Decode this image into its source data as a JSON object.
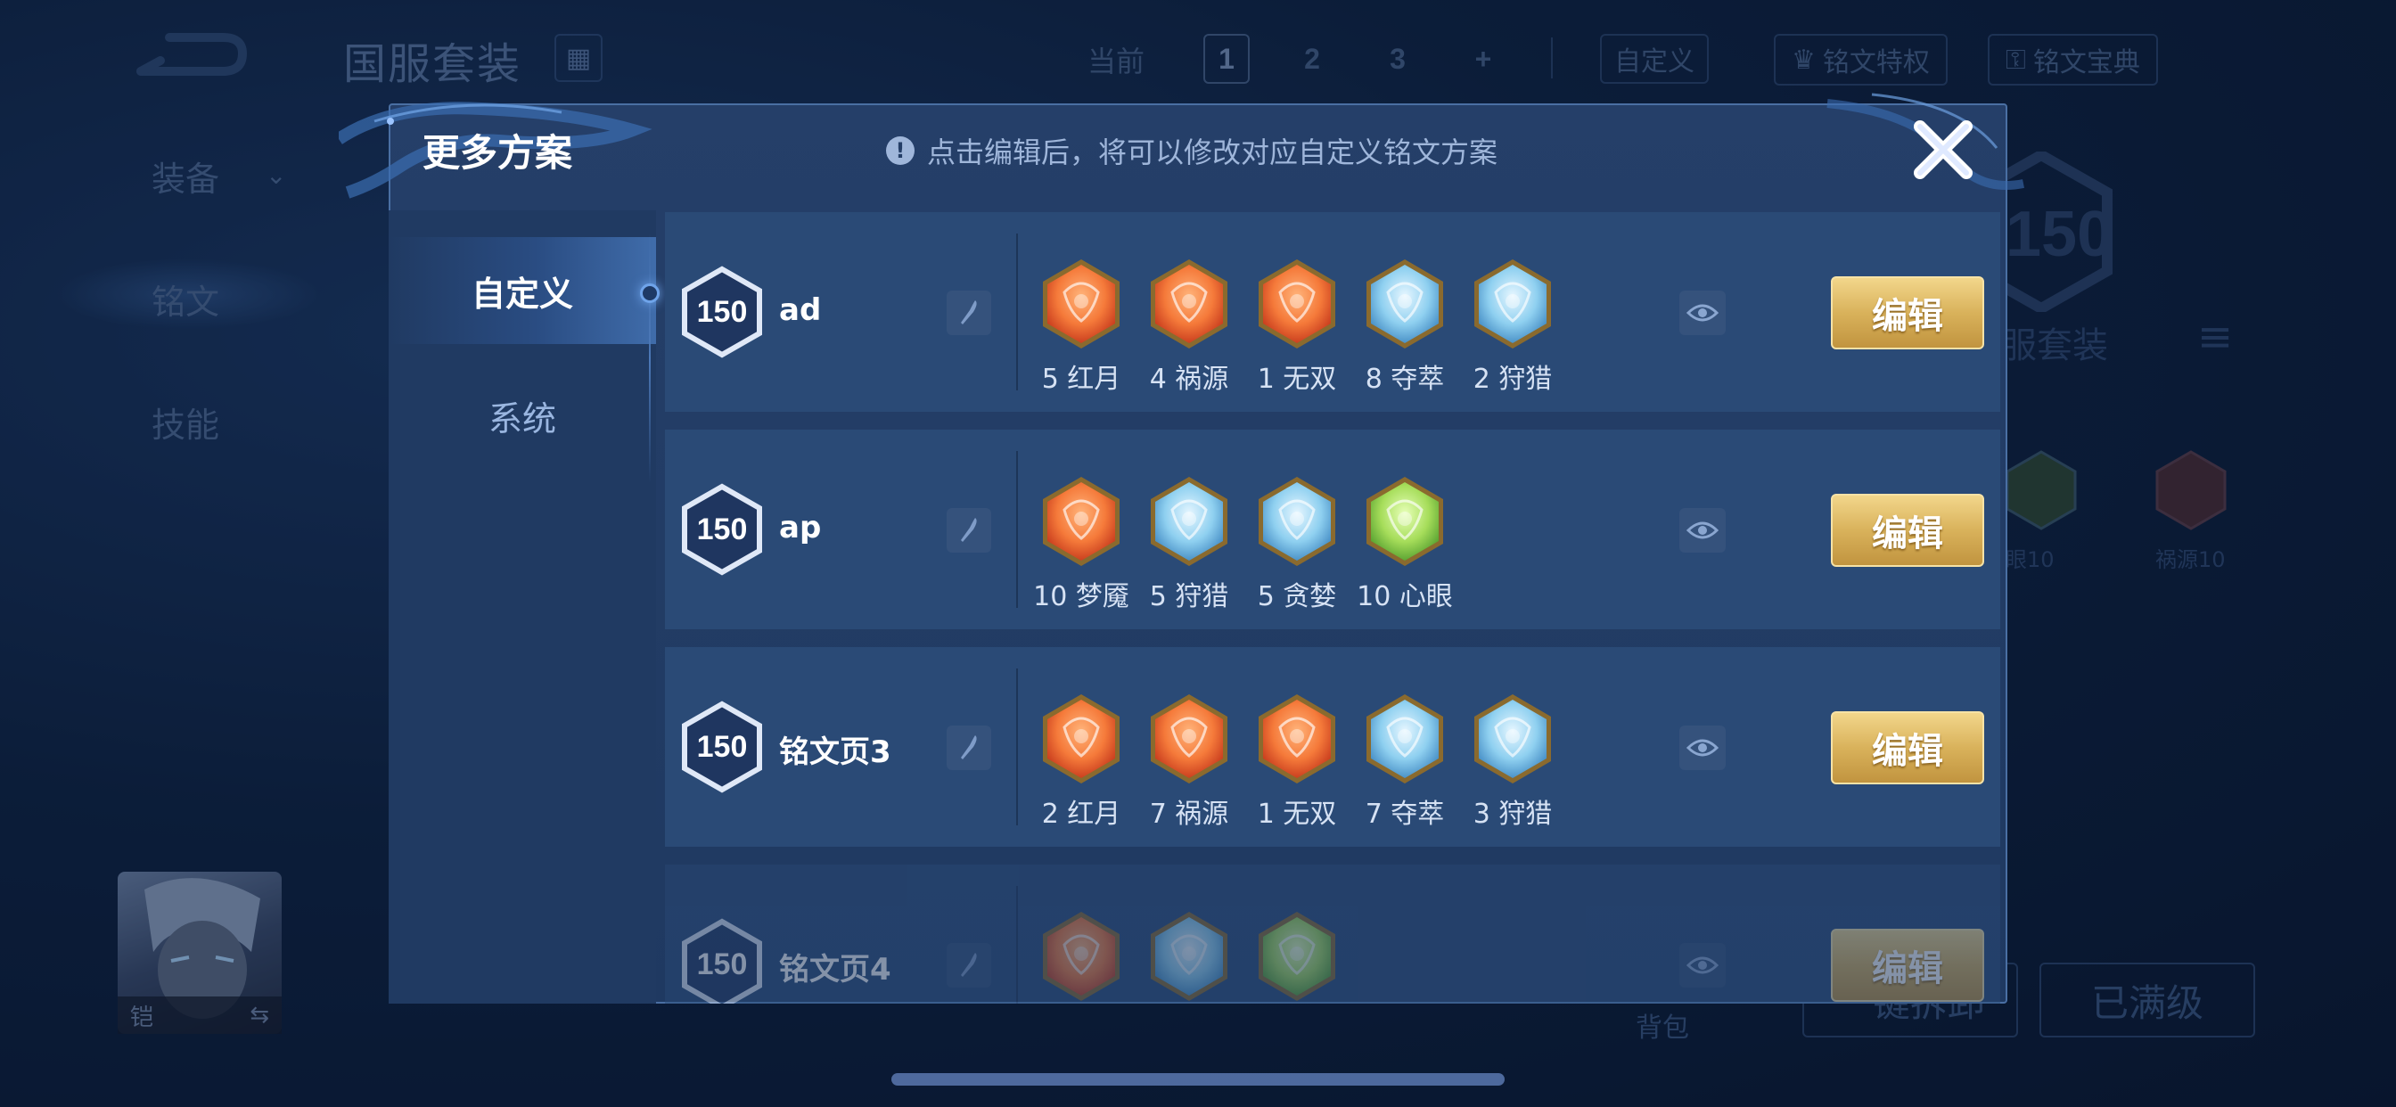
{
  "background": {
    "page_title": "国服套装",
    "current_label": "当前",
    "page_numbers": [
      "1",
      "2",
      "3",
      "+"
    ],
    "selected_page": "1",
    "custom_label": "自定义",
    "links": [
      "铭文特权",
      "铭文宝典"
    ],
    "side_nav": [
      "装备",
      "铭文",
      "技能"
    ],
    "hero_name": "铠",
    "right_level": "150",
    "right_set_label": "服套装",
    "right_items": [
      "眼10",
      "祸源10"
    ],
    "bag_label": "背包",
    "btn_left": "一键拆卸",
    "btn_right": "已满级"
  },
  "modal": {
    "title": "更多方案",
    "hint": "点击编辑后，将可以修改对应自定义铭文方案",
    "tabs": [
      "自定义",
      "系统"
    ],
    "active_tab": "自定义",
    "edit_label": "编辑",
    "rows": [
      {
        "level": "150",
        "name": "ad",
        "runes": [
          {
            "count": "5",
            "name": "红月",
            "color": "red"
          },
          {
            "count": "4",
            "name": "祸源",
            "color": "red"
          },
          {
            "count": "1",
            "name": "无双",
            "color": "red"
          },
          {
            "count": "8",
            "name": "夺萃",
            "color": "blue"
          },
          {
            "count": "2",
            "name": "狩猎",
            "color": "blue"
          }
        ]
      },
      {
        "level": "150",
        "name": "ap",
        "runes": [
          {
            "count": "10",
            "name": "梦魇",
            "color": "red"
          },
          {
            "count": "5",
            "name": "狩猎",
            "color": "blue"
          },
          {
            "count": "5",
            "name": "贪婪",
            "color": "blue"
          },
          {
            "count": "10",
            "name": "心眼",
            "color": "green"
          }
        ]
      },
      {
        "level": "150",
        "name": "铭文页3",
        "runes": [
          {
            "count": "2",
            "name": "红月",
            "color": "red"
          },
          {
            "count": "7",
            "name": "祸源",
            "color": "red"
          },
          {
            "count": "1",
            "name": "无双",
            "color": "red"
          },
          {
            "count": "7",
            "name": "夺萃",
            "color": "blue"
          },
          {
            "count": "3",
            "name": "狩猎",
            "color": "blue"
          }
        ]
      },
      {
        "level": "150",
        "name": "铭文页4",
        "runes": [
          {
            "count": "",
            "name": "",
            "color": "red"
          },
          {
            "count": "",
            "name": "",
            "color": "blue"
          },
          {
            "count": "",
            "name": "",
            "color": "green"
          }
        ]
      }
    ]
  },
  "colors": {
    "rune_red": "#e2542a",
    "rune_blue": "#4f9fd6",
    "rune_green": "#5aa83a",
    "gold": "#d9b25b"
  }
}
